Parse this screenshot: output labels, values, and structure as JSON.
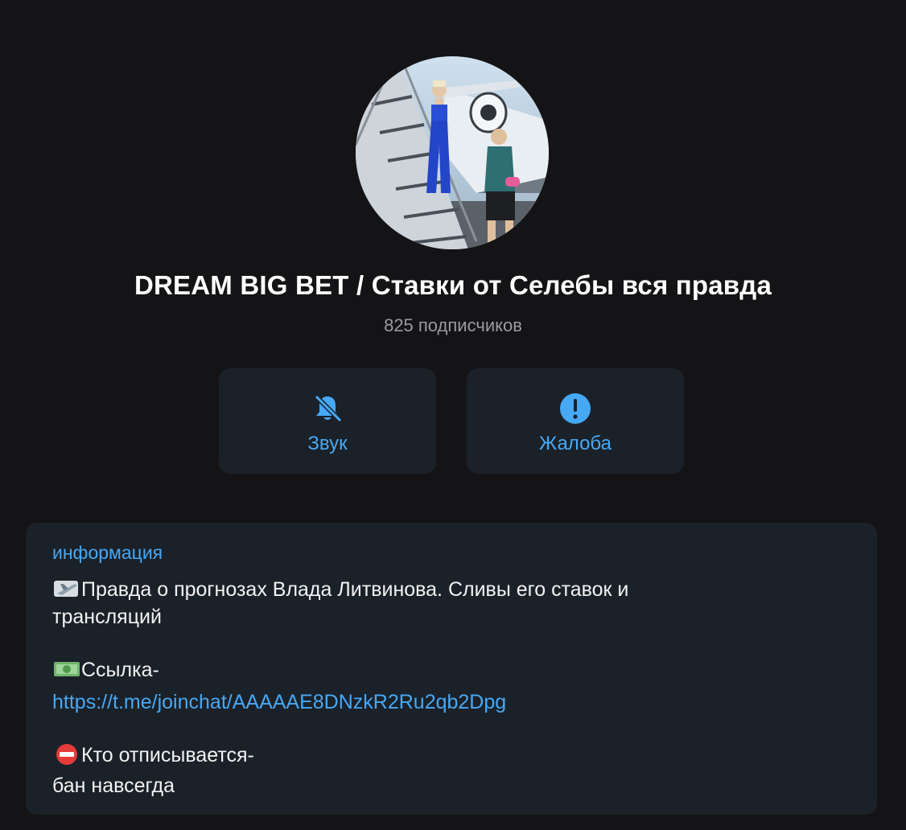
{
  "channel": {
    "title": "DREAM BIG BET / Ставки от Селебы вся правда",
    "subscribers": "825 подписчиков"
  },
  "actions": {
    "sound_label": "Звук",
    "sound_icon": "bell-muted-icon",
    "report_label": "Жалоба",
    "report_icon": "exclamation-circle-icon"
  },
  "info": {
    "heading": "информация",
    "line1": "Правда о прогнозах Влада Литвинова. Сливы его ставок и",
    "line2": "трансляций",
    "link_label_text": "Ссылка-",
    "link_url": "https://t.me/joinchat/AAAAAE8DNzkR2Ru2qb2Dpg",
    "warning_line1": "Кто отписывается-",
    "warning_line2": "бан навсегда",
    "emoji_1": "airplane-emoji",
    "emoji_2": "money-emoji",
    "emoji_3": "no-entry-emoji"
  },
  "colors": {
    "background": "#141416",
    "card": "#1b2128",
    "accent": "#47a8f5",
    "muted_text": "#9a9aa0"
  }
}
